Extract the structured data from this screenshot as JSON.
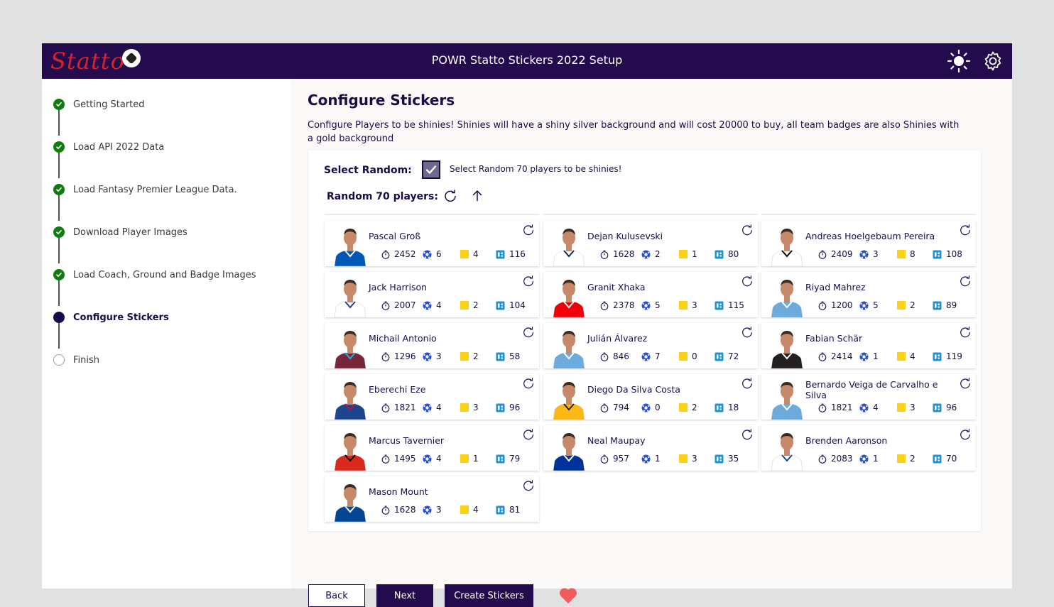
{
  "app": {
    "logo_text": "Statto",
    "title": "POWR Statto Stickers 2022 Setup"
  },
  "steps": [
    {
      "label": "Getting Started",
      "state": "done"
    },
    {
      "label": "Load API 2022 Data",
      "state": "done"
    },
    {
      "label": "Load Fantasy Premier League Data.",
      "state": "done"
    },
    {
      "label": "Download Player Images",
      "state": "done"
    },
    {
      "label": "Load Coach, Ground and Badge Images",
      "state": "done"
    },
    {
      "label": "Configure Stickers",
      "state": "current"
    },
    {
      "label": "Finish",
      "state": "pending"
    }
  ],
  "main": {
    "title": "Configure Stickers",
    "description": "Configure Players to be shinies! Shinies will have a shiny silver background and will cost 20000 to buy, all team badges are also Shinies with a gold background",
    "select_random_label": "Select Random:",
    "select_random_text": "Select Random 70 players to be shinies!",
    "random_players_label": "Random 70 players:"
  },
  "players": [
    {
      "name": "Pascal Groß",
      "minutes": "2452",
      "goals": "6",
      "yellow": "4",
      "points": "116",
      "kit": "#0057b8",
      "kit2": "#ffffff"
    },
    {
      "name": "Dejan Kulusevski",
      "minutes": "1628",
      "goals": "2",
      "yellow": "1",
      "points": "80",
      "kit": "#ffffff",
      "kit2": "#132257"
    },
    {
      "name": "Andreas Hoelgebaum Pereira",
      "minutes": "2409",
      "goals": "3",
      "yellow": "8",
      "points": "108",
      "kit": "#ffffff",
      "kit2": "#000000"
    },
    {
      "name": "Jack Harrison",
      "minutes": "2007",
      "goals": "4",
      "yellow": "2",
      "points": "104",
      "kit": "#ffffff",
      "kit2": "#1d428a"
    },
    {
      "name": "Granit Xhaka",
      "minutes": "2378",
      "goals": "5",
      "yellow": "3",
      "points": "115",
      "kit": "#ef0107",
      "kit2": "#ffffff"
    },
    {
      "name": "Riyad Mahrez",
      "minutes": "1200",
      "goals": "5",
      "yellow": "2",
      "points": "89",
      "kit": "#6cabdd",
      "kit2": "#ffffff"
    },
    {
      "name": "Michail Antonio",
      "minutes": "1296",
      "goals": "3",
      "yellow": "2",
      "points": "58",
      "kit": "#7a263a",
      "kit2": "#1bb1e7"
    },
    {
      "name": "Julián Álvarez",
      "minutes": "846",
      "goals": "7",
      "yellow": "0",
      "points": "72",
      "kit": "#6cabdd",
      "kit2": "#ffffff"
    },
    {
      "name": "Fabian Schär",
      "minutes": "2414",
      "goals": "1",
      "yellow": "4",
      "points": "119",
      "kit": "#241f20",
      "kit2": "#ffffff"
    },
    {
      "name": "Eberechi Eze",
      "minutes": "1821",
      "goals": "4",
      "yellow": "3",
      "points": "96",
      "kit": "#1b458f",
      "kit2": "#c4122e"
    },
    {
      "name": "Diego Da Silva Costa",
      "minutes": "794",
      "goals": "0",
      "yellow": "2",
      "points": "18",
      "kit": "#fdb913",
      "kit2": "#231f20"
    },
    {
      "name": "Bernardo Veiga de Carvalho e Silva",
      "minutes": "1821",
      "goals": "4",
      "yellow": "3",
      "points": "96",
      "kit": "#6cabdd",
      "kit2": "#ffffff"
    },
    {
      "name": "Marcus Tavernier",
      "minutes": "1495",
      "goals": "4",
      "yellow": "1",
      "points": "79",
      "kit": "#da291c",
      "kit2": "#000000"
    },
    {
      "name": "Neal Maupay",
      "minutes": "957",
      "goals": "1",
      "yellow": "3",
      "points": "35",
      "kit": "#003399",
      "kit2": "#ffffff"
    },
    {
      "name": "Brenden Aaronson",
      "minutes": "2083",
      "goals": "1",
      "yellow": "2",
      "points": "70",
      "kit": "#ffffff",
      "kit2": "#1d428a"
    },
    {
      "name": "Mason Mount",
      "minutes": "1628",
      "goals": "3",
      "yellow": "4",
      "points": "81",
      "kit": "#034694",
      "kit2": "#ffffff"
    }
  ],
  "buttons": {
    "back": "Back",
    "next": "Next",
    "create": "Create Stickers"
  },
  "colors": {
    "brand": "#230b4d",
    "done": "#107c10",
    "heart": "#f15b5b"
  },
  "icons": [
    "sun-icon",
    "gear-icon",
    "refresh-icon",
    "arrow-up-icon",
    "stopwatch-icon",
    "football-icon",
    "yellow-card-icon",
    "points-icon",
    "heart-icon",
    "check-icon"
  ]
}
